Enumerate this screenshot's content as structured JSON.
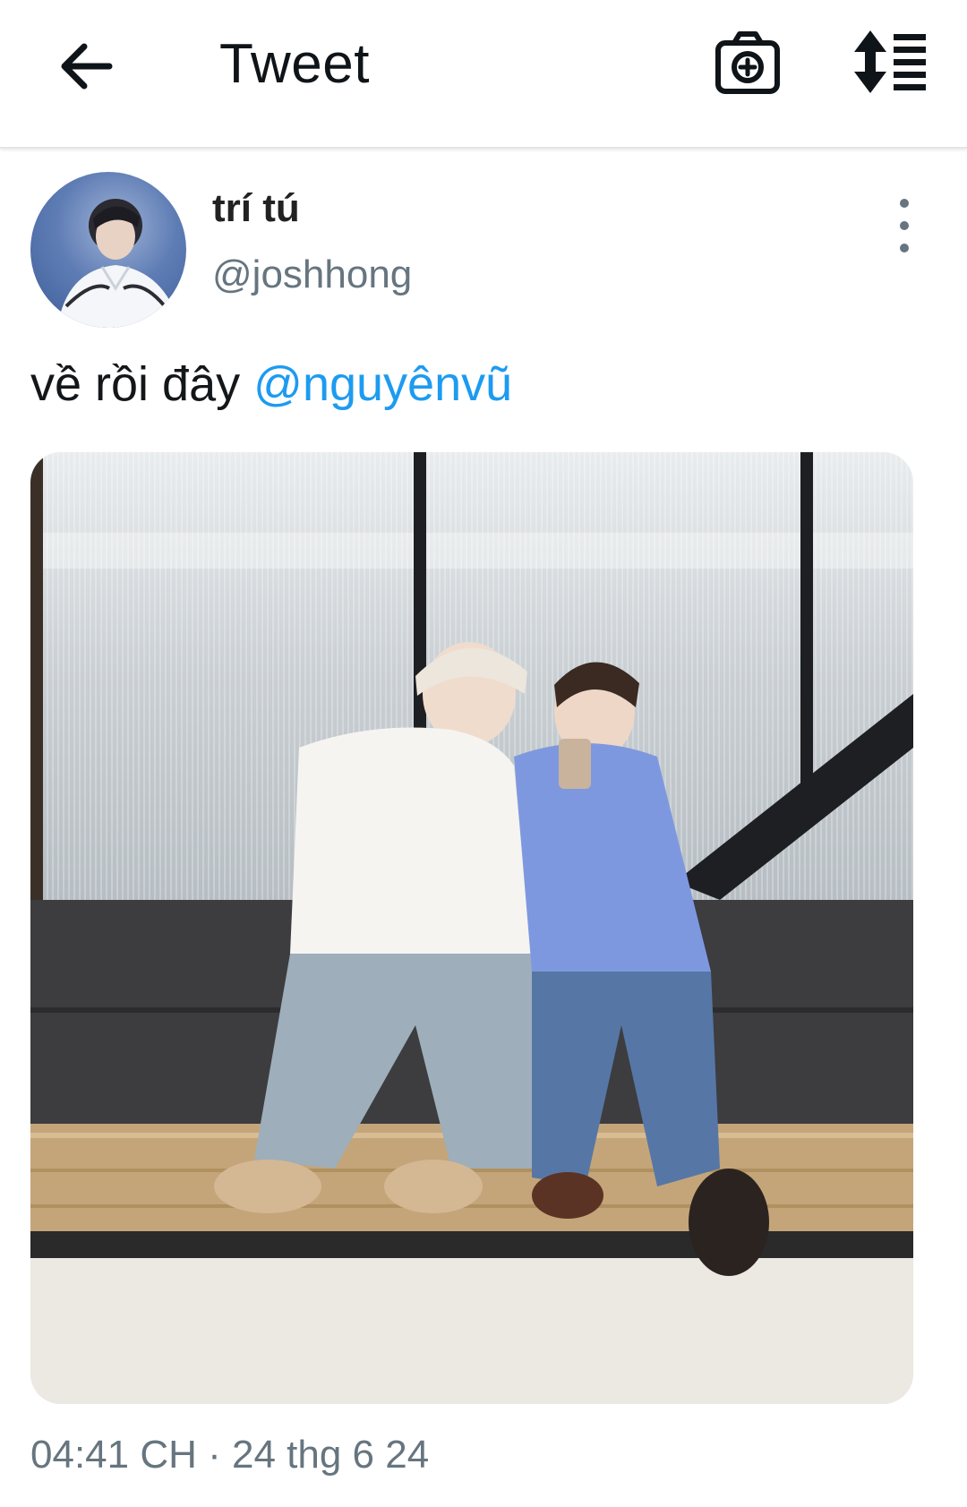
{
  "header": {
    "title": "Tweet"
  },
  "tweet": {
    "author_name": "trí tú",
    "author_handle": "@joshhong",
    "text_prefix": "về rồi đây ",
    "mention": "@nguyênvũ",
    "timestamp": "04:41 CH · 24 thg 6 24"
  },
  "icons": {
    "back": "arrow-left-icon",
    "camera": "camera-plus-icon",
    "sort": "sort-list-icon",
    "more": "more-vertical-icon"
  },
  "colors": {
    "link": "#1d9bf0",
    "secondary_text": "#66757f"
  }
}
